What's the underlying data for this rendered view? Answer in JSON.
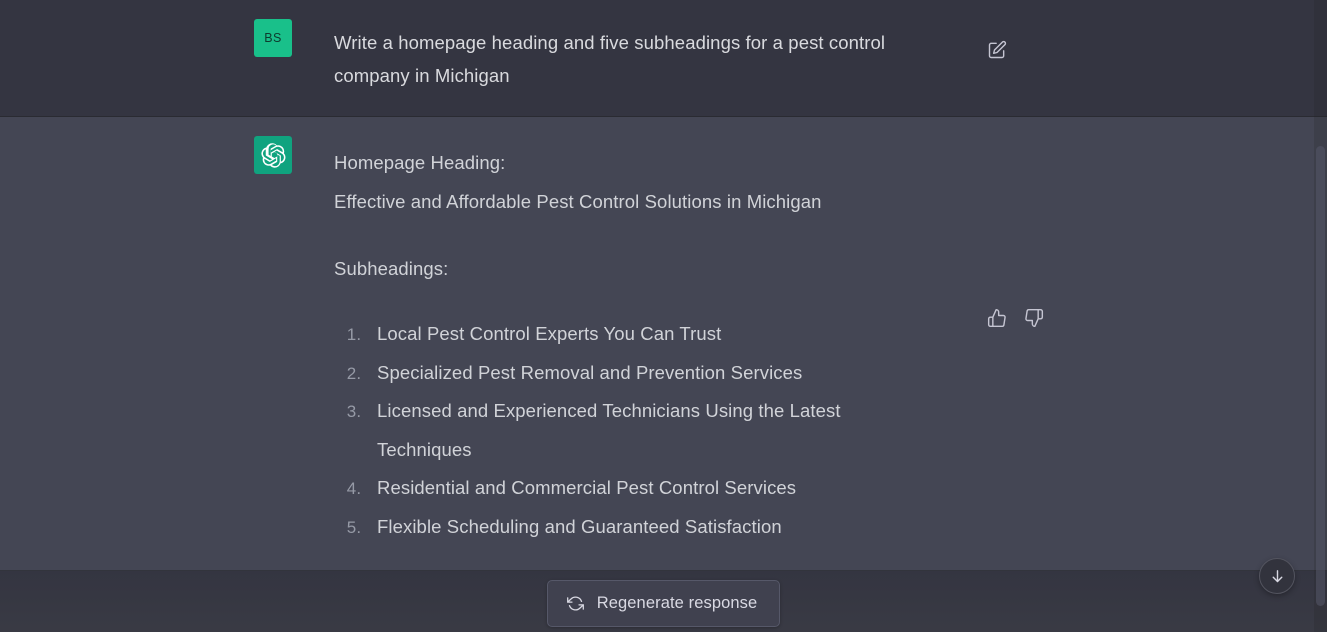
{
  "conversation": {
    "messages": [
      {
        "role": "user",
        "avatar_initials": "BS",
        "avatar_color": "#19c08a",
        "text": "Write a homepage heading and five subheadings for a pest control company in Michigan",
        "actions": [
          {
            "name": "edit-icon",
            "label": "Edit message"
          }
        ]
      },
      {
        "role": "assistant",
        "avatar_icon": "openai-logo-icon",
        "avatar_color": "#10a37f",
        "heading_label": "Homepage Heading:",
        "heading_value": "Effective and Affordable Pest Control Solutions in Michigan",
        "subheadings_label": "Subheadings:",
        "subheadings": [
          "Local Pest Control Experts You Can Trust",
          "Specialized Pest Removal and Prevention Services",
          "Licensed and Experienced Technicians Using the Latest Techniques",
          "Residential and Commercial Pest Control Services",
          "Flexible Scheduling and Guaranteed Satisfaction"
        ],
        "actions": [
          {
            "name": "thumbs-up-icon",
            "label": "Good response"
          },
          {
            "name": "thumbs-down-icon",
            "label": "Bad response"
          }
        ]
      }
    ]
  },
  "footer": {
    "regenerate_label": "Regenerate response",
    "regenerate_icon": "refresh-icon"
  },
  "scroll_to_bottom": {
    "icon": "arrow-down-icon",
    "label": "Scroll to bottom"
  },
  "colors": {
    "user_bg": "#343541",
    "assistant_bg": "#444654",
    "accent_green": "#10a37f",
    "text": "#d1d3d8",
    "muted": "#969aa6",
    "button_bg": "#40414f",
    "button_border": "#565869"
  }
}
